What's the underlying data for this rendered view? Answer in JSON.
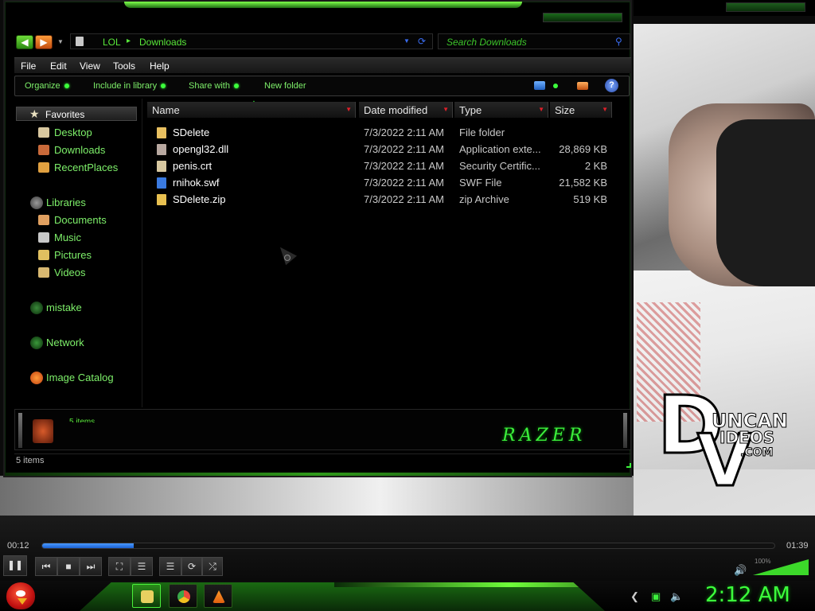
{
  "window": {
    "address": {
      "crumbs": [
        "LOL",
        "Downloads"
      ]
    },
    "search": {
      "placeholder": "Search Downloads"
    },
    "menu": [
      "File",
      "Edit",
      "View",
      "Tools",
      "Help"
    ],
    "commands": [
      "Organize",
      "Include in library",
      "Share with",
      "New folder"
    ],
    "nav": {
      "favorites_label": "Favorites",
      "favorites": [
        {
          "label": "Desktop",
          "icon": "desktop-icon",
          "color": "#d9c8a0"
        },
        {
          "label": "Downloads",
          "icon": "downloads-icon",
          "color": "#c96a3a"
        },
        {
          "label": "RecentPlaces",
          "icon": "recent-places-icon",
          "color": "#e0a040"
        }
      ],
      "libraries_label": "Libraries",
      "libraries": [
        {
          "label": "Documents",
          "icon": "documents-icon",
          "color": "#e0a060"
        },
        {
          "label": "Music",
          "icon": "music-icon",
          "color": "#c8c8c8"
        },
        {
          "label": "Pictures",
          "icon": "pictures-icon",
          "color": "#e0c060"
        },
        {
          "label": "Videos",
          "icon": "videos-icon",
          "color": "#d8b870"
        }
      ],
      "homegroup_label": "mistake",
      "network_label": "Network",
      "catalog_label": "Image Catalog"
    },
    "columns": {
      "name": "Name",
      "date": "Date modified",
      "type": "Type",
      "size": "Size"
    },
    "files": [
      {
        "name": "SDelete",
        "date": "7/3/2022 2:11 AM",
        "type": "File folder",
        "size": "",
        "icon": "folder-icon",
        "color": "#e8c060"
      },
      {
        "name": "opengl32.dll",
        "date": "7/3/2022 2:11 AM",
        "type": "Application exte...",
        "size": "28,869 KB",
        "icon": "dll-file-icon",
        "color": "#b8a8a0"
      },
      {
        "name": "penis.crt",
        "date": "7/3/2022 2:11 AM",
        "type": "Security Certific...",
        "size": "2 KB",
        "icon": "certificate-icon",
        "color": "#d8c8a0"
      },
      {
        "name": "rnihok.swf",
        "date": "7/3/2022 2:11 AM",
        "type": "SWF File",
        "size": "21,582 KB",
        "icon": "swf-file-icon",
        "color": "#3a7ae0"
      },
      {
        "name": "SDelete.zip",
        "date": "7/3/2022 2:11 AM",
        "type": "zip Archive",
        "size": "519 KB",
        "icon": "zip-file-icon",
        "color": "#e8c050"
      }
    ],
    "details": {
      "count": "5 items",
      "brand": "RAZER"
    },
    "status": "5 items"
  },
  "watermark": {
    "line1": "UNCAN",
    "line2": "IDEOS",
    "line3": ".COM",
    "d": "D",
    "v": "V"
  },
  "player": {
    "elapsed": "00:12",
    "total": "01:39",
    "progress": 0.125,
    "volume": "100%",
    "buttons": [
      "pause",
      "previous",
      "stop",
      "next",
      "fullscreen",
      "equalizer",
      "playlist",
      "repeat",
      "shuffle"
    ]
  },
  "taskbar": {
    "apps": [
      "explorer",
      "chrome",
      "vlc"
    ],
    "clock": "2:12 AM"
  },
  "colors": {
    "accent": "#3cff3c",
    "link": "#7ef06a",
    "seek": "#2a7ae8",
    "close": "#e0202a"
  }
}
